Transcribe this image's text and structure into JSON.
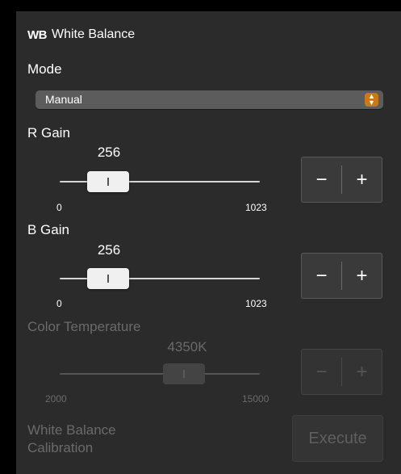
{
  "header": {
    "icon_text": "WB",
    "title": "White Balance"
  },
  "mode": {
    "label": "Mode",
    "selected": "Manual"
  },
  "r_gain": {
    "label": "R Gain",
    "value": "256",
    "min": "0",
    "max": "1023",
    "level": 256
  },
  "b_gain": {
    "label": "B Gain",
    "value": "256",
    "min": "0",
    "max": "1023",
    "level": 256
  },
  "color_temperature": {
    "label": "Color Temperature",
    "value": "4350K",
    "min": "2000",
    "max": "15000",
    "level": 4350
  },
  "stepper": {
    "minus": "−",
    "plus": "+"
  },
  "calibration": {
    "label": "White Balance Calibration",
    "button": "Execute"
  },
  "colors": {
    "panel": "#2b2b2b",
    "select_bg": "#5c5c5c",
    "accent": "#c77a1a",
    "disabled_text": "#6a6a6a"
  }
}
